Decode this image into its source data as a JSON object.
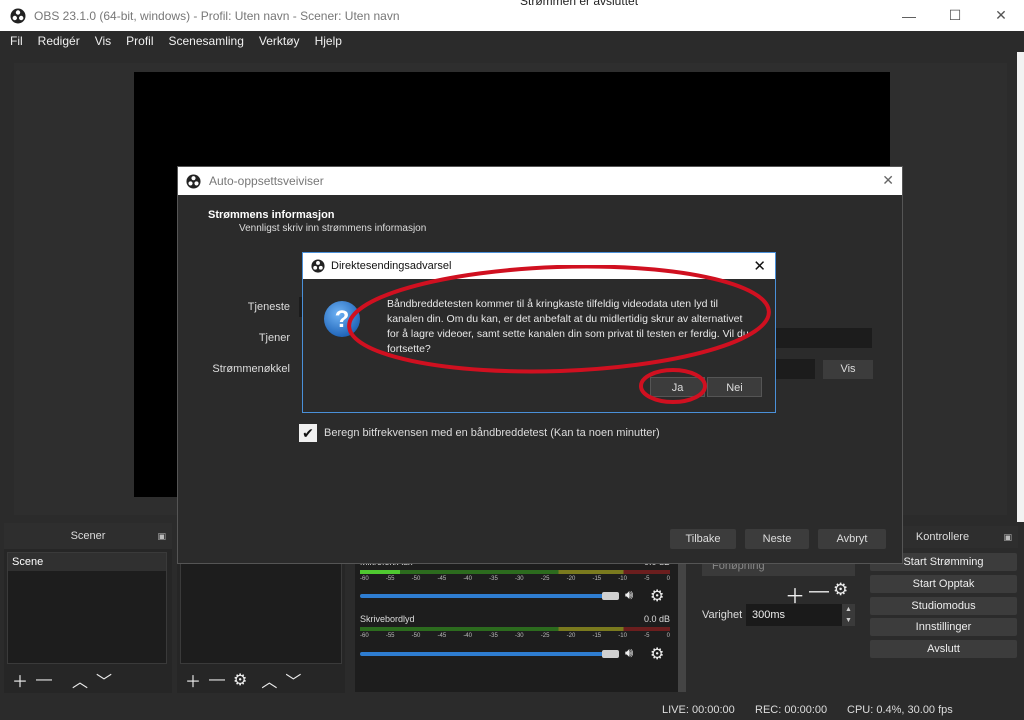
{
  "window": {
    "title": "OBS 23.1.0 (64-bit, windows) - Profil: Uten navn - Scener: Uten navn",
    "behind_title": "Strømmen er avsluttet",
    "behind_right": "..."
  },
  "menu": [
    "Fil",
    "Redigér",
    "Vis",
    "Profil",
    "Scenesamling",
    "Verktøy",
    "Hjelp"
  ],
  "scenes": {
    "header": "Scener",
    "items": [
      "Scene"
    ]
  },
  "mixer": {
    "tracks": [
      {
        "name": "Mikrofon/Aux",
        "db": "0.0 dB"
      },
      {
        "name": "Skrivebordlyd",
        "db": "0.0 dB"
      }
    ],
    "ticks": [
      "-60",
      "-55",
      "-50",
      "-45",
      "-40",
      "-35",
      "-30",
      "-25",
      "-20",
      "-15",
      "-10",
      "-5",
      "0"
    ]
  },
  "transitions": {
    "selected": "Fonøpning",
    "duration_label": "Varighet",
    "duration_value": "300ms"
  },
  "controls": {
    "header": "Kontrollere",
    "buttons": [
      "Start Strømming",
      "Start Opptak",
      "Studiomodus",
      "Innstillinger",
      "Avslutt"
    ]
  },
  "status": {
    "live": "LIVE: 00:00:00",
    "rec": "REC: 00:00:00",
    "cpu": "CPU: 0.4%, 30.00 fps"
  },
  "wizard": {
    "title": "Auto-oppsettsveiviser",
    "heading": "Strømmens informasjon",
    "subheading": "Vennligst skriv inn strømmens informasjon",
    "service_label": "Tjeneste",
    "server_label": "Tjener",
    "key_label": "Strømmenøkkel",
    "show_button": "Vis",
    "bandwidth_check_label": "Beregn bitfrekvensen med en båndbreddetest (Kan ta noen minutter)",
    "bandwidth_checked": true,
    "back": "Tilbake",
    "next": "Neste",
    "cancel": "Avbryt"
  },
  "warning": {
    "title": "Direktesendingsadvarsel",
    "message": "Båndbreddetesten kommer til å kringkaste tilfeldig videodata uten lyd til kanalen din. Om du kan, er det anbefalt at du midlertidig skrur av alternativet for å lagre videoer, samt sette kanalen din som privat til testen er ferdig. Vil du fortsette?",
    "yes": "Ja",
    "no": "Nei",
    "annotation_color": "#d01020"
  }
}
